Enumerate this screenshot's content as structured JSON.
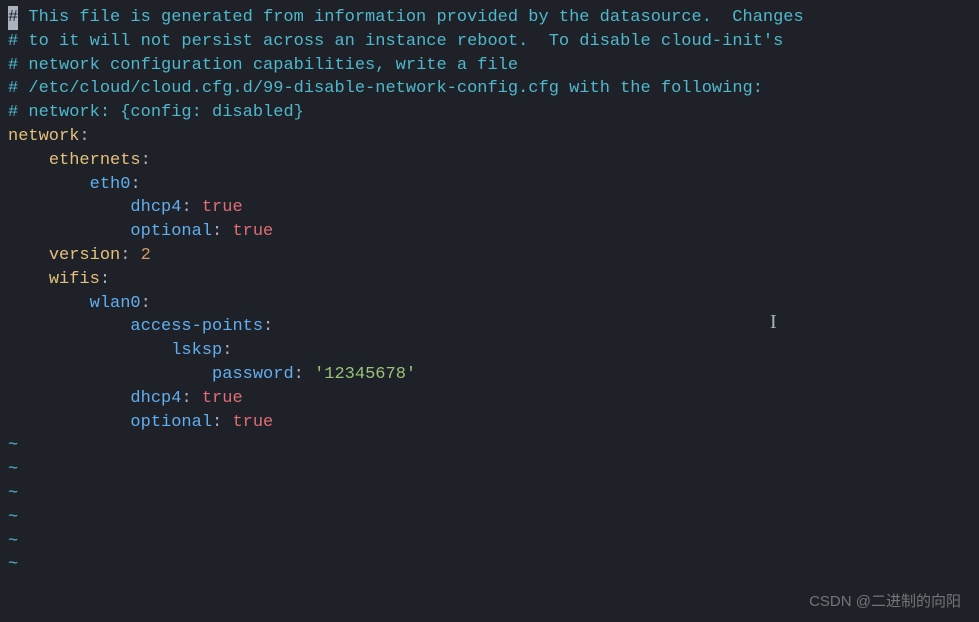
{
  "editor": {
    "comments": [
      " This file is generated from information provided by the datasource.  Changes",
      "# to it will not persist across an instance reboot.  To disable cloud-init's",
      "# network configuration capabilities, write a file",
      "# /etc/cloud/cloud.cfg.d/99-disable-network-config.cfg with the following:",
      "# network: {config: disabled}"
    ],
    "cursor_char": "#",
    "yaml": {
      "network": "network",
      "ethernets": "ethernets",
      "eth0": "eth0",
      "dhcp4": "dhcp4",
      "optional": "optional",
      "true_val": "true",
      "version": "version",
      "version_num": "2",
      "wifis": "wifis",
      "wlan0": "wlan0",
      "access_points": "access-points",
      "lsksp": "lsksp",
      "password": "password",
      "password_val": "'12345678'"
    },
    "tilde": "~"
  },
  "watermark": "CSDN @二进制的向阳",
  "text_cursor_glyph": "I"
}
